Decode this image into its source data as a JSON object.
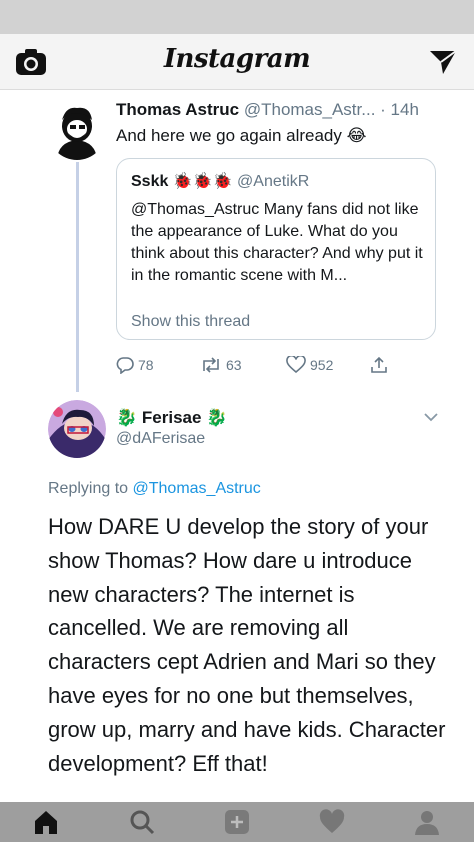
{
  "instagram": {
    "title": "Instagram",
    "icons": [
      "camera-icon",
      "send-icon"
    ],
    "tabs": [
      "home-icon",
      "search-icon",
      "add-icon",
      "heart-icon",
      "profile-icon"
    ]
  },
  "tweet": {
    "author_name": "Thomas Astruc",
    "author_meta": " @Thomas_Astr... · 14h",
    "text": "And here we go again already 😂",
    "quote": {
      "name": "Sskk",
      "emoji": "🐞🐞🐞",
      "handle": "@AnetikR",
      "body": "@Thomas_Astruc Many fans did not like the appearance of Luke. What do you think about this character? And why put it in the romantic scene with M...",
      "show_thread": "Show this thread"
    },
    "replies": "78",
    "retweets": "63",
    "likes": "952"
  },
  "reply": {
    "name": "🐉 Ferisae 🐉",
    "handle": "@dAFerisae",
    "replying_prefix": "Replying to ",
    "replying_to": "@Thomas_Astruc",
    "text": "How DARE U develop the story of your show Thomas? How dare u introduce new characters? The internet is cancelled. We are removing all characters cept Adrien and Mari so they have eyes for no one but themselves, grow up, marry and have kids. Character development? Eff that!"
  },
  "colors": {
    "link": "#1b95e0",
    "secondary_text": "#657786",
    "thread_line": "#c5d0e6"
  }
}
